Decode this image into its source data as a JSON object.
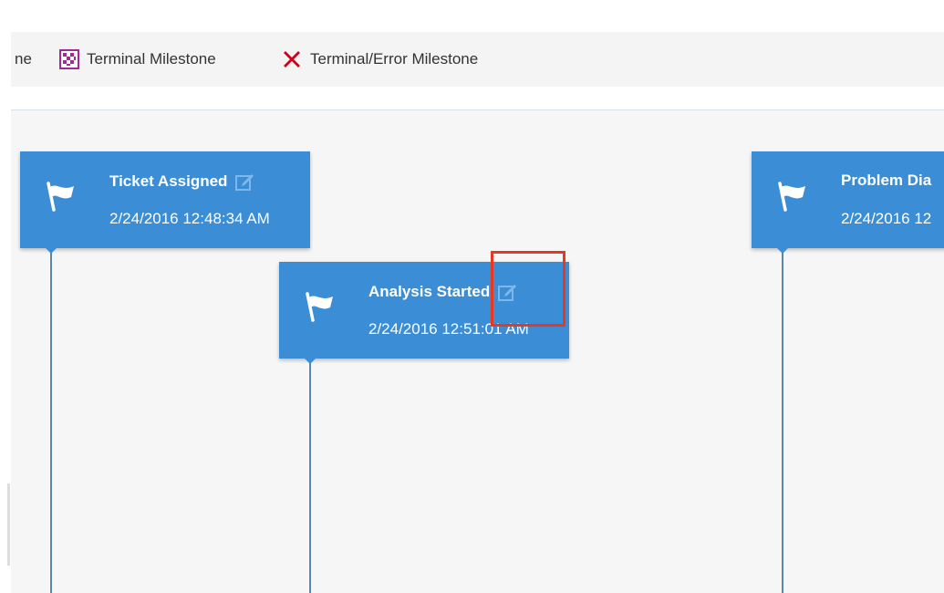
{
  "legend": {
    "cut_label": "ne",
    "terminal_label": "Terminal Milestone",
    "error_label": "Terminal/Error Milestone",
    "colors": {
      "terminal": "#a02b93",
      "error": "#d0021b"
    }
  },
  "milestones": [
    {
      "title": "Ticket Assigned",
      "time": "2/24/2016 12:48:34 AM",
      "icon": "flag-icon",
      "action_icon": "edit-icon"
    },
    {
      "title": "Analysis Started",
      "time": "2/24/2016 12:51:01 AM",
      "icon": "flag-icon",
      "action_icon": "edit-icon"
    },
    {
      "title": "Problem Dia",
      "time": "2/24/2016 12",
      "icon": "flag-icon"
    }
  ],
  "colors": {
    "milestone_bg": "#3b8ed6",
    "stem": "#5b87ad",
    "highlight": "#e8391f"
  }
}
